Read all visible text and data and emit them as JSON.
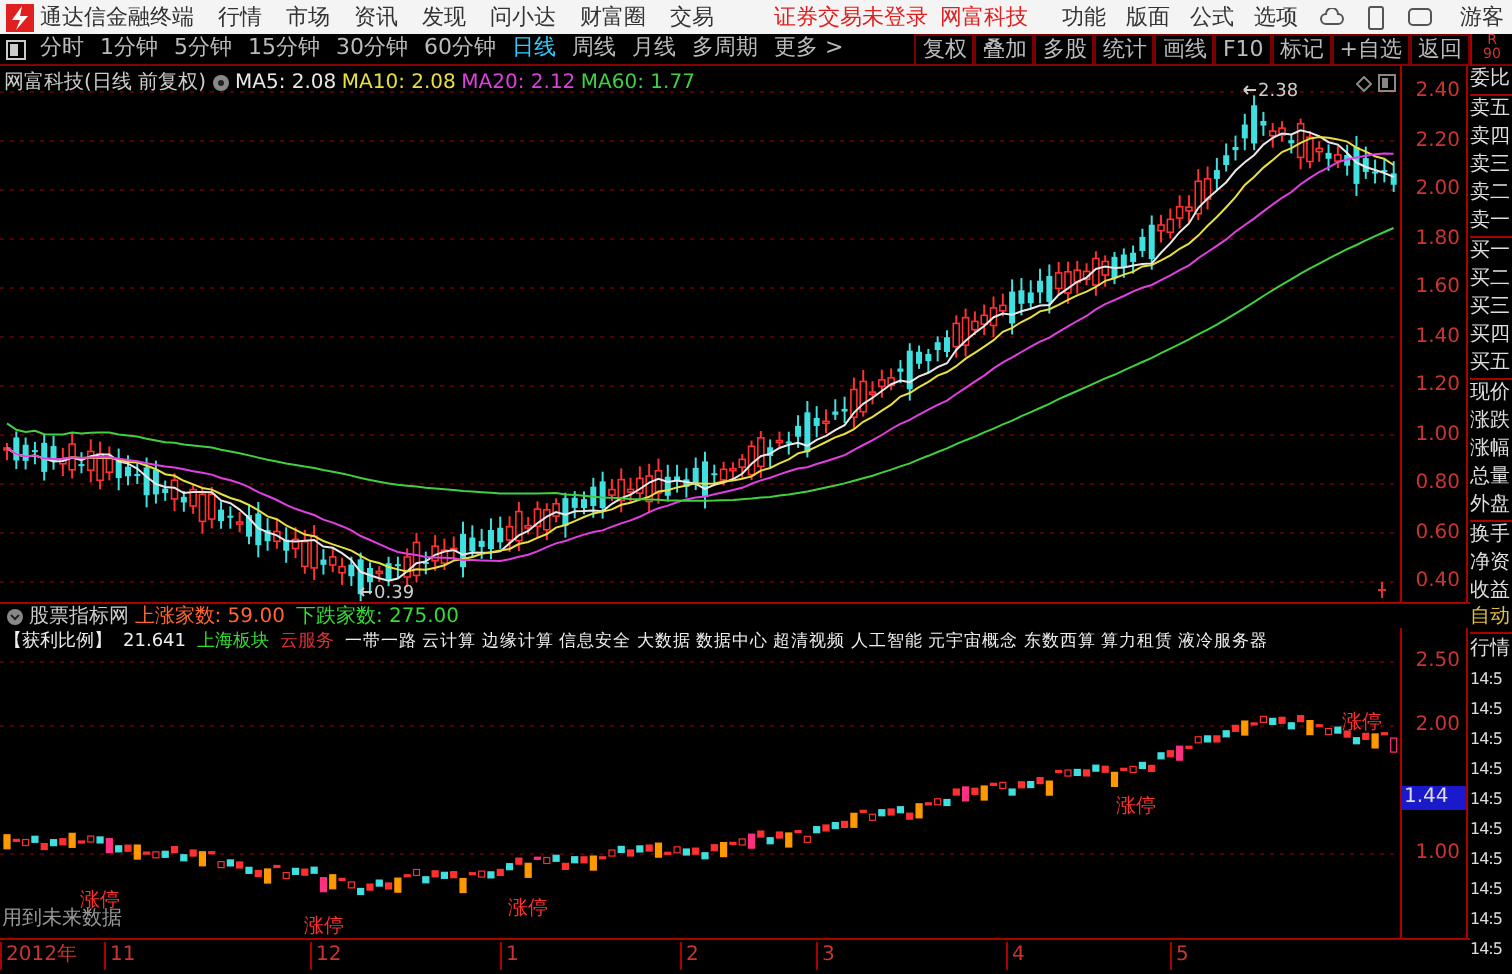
{
  "app_bar": {
    "title": "通达信金融终端",
    "menu": [
      "行情",
      "市场",
      "资讯",
      "发现",
      "问小达",
      "财富圈",
      "交易"
    ],
    "login_status": "证券交易未登录",
    "broker": "网富科技",
    "right_menu": [
      "功能",
      "版面",
      "公式",
      "选项"
    ],
    "user": "游客"
  },
  "period_tabs": [
    {
      "label": "分时",
      "selected": false
    },
    {
      "label": "1分钟",
      "selected": false
    },
    {
      "label": "5分钟",
      "selected": false
    },
    {
      "label": "15分钟",
      "selected": false
    },
    {
      "label": "30分钟",
      "selected": false
    },
    {
      "label": "60分钟",
      "selected": false
    },
    {
      "label": "日线",
      "selected": true
    },
    {
      "label": "周线",
      "selected": false
    },
    {
      "label": "月线",
      "selected": false
    },
    {
      "label": "多周期",
      "selected": false
    },
    {
      "label": "更多 >",
      "selected": false
    }
  ],
  "tool_buttons": [
    "复权",
    "叠加",
    "多股",
    "统计",
    "画线",
    "F10",
    "标记",
    "+自选",
    "返回"
  ],
  "corner_label": [
    "R",
    "90"
  ],
  "main_chart": {
    "title": "网富科技(日线 前复权)",
    "ma": [
      {
        "label": "MA5: 2.08",
        "color": "#e8e8e8"
      },
      {
        "label": "MA10: 2.08",
        "color": "#e8e040"
      },
      {
        "label": "MA20: 2.12",
        "color": "#e040e0"
      },
      {
        "label": "MA60: 1.77",
        "color": "#40d040"
      }
    ],
    "high_label": "2.38",
    "low_label": "0.39",
    "y_ticks": [
      "2.40",
      "2.20",
      "2.00",
      "1.80",
      "1.60",
      "1.40",
      "1.20",
      "1.00",
      "0.80",
      "0.60",
      "0.40"
    ]
  },
  "quote_groups": [
    [
      "委比"
    ],
    [
      "卖五",
      "卖四",
      "卖三",
      "卖二",
      "卖一"
    ],
    [
      "买一",
      "买二",
      "买三",
      "买四",
      "买五"
    ],
    [
      "现价",
      "涨跌",
      "涨幅",
      "总量",
      "外盘"
    ],
    [
      "换手",
      "净资",
      "收益"
    ]
  ],
  "indicator": {
    "name": "股票指标网",
    "stats": [
      {
        "label": "上涨家数: 59.00",
        "color": "#ff6633"
      },
      {
        "label": "下跌家数: 275.00",
        "color": "#33dd33"
      }
    ]
  },
  "info_row": {
    "label": "【获利比例】",
    "value": "21.641",
    "sector": "上海板块",
    "concept": "云服务",
    "concepts": "一带一路 云计算 边缘计算 信息安全 大数据 数据中心 超清视频 人工智能 元宇宙概念 东数西算 算力租赁 液冷服务器"
  },
  "lower_chart": {
    "y_ticks": [
      "2.50",
      "2.00",
      "1.00"
    ],
    "current": "1.44",
    "limit_up_labels": [
      "涨停",
      "涨停",
      "涨停",
      "涨停",
      "涨停"
    ],
    "note": "用到未来数据"
  },
  "side_panel": {
    "mode": "自动",
    "tab": "行情",
    "times": [
      "14:5",
      "14:5",
      "14:5",
      "14:5",
      "14:5",
      "14:5",
      "14:5",
      "14:5",
      "14:5",
      "14:5"
    ]
  },
  "x_axis": [
    "2012年",
    "11",
    "12",
    "1",
    "2",
    "3",
    "4",
    "5"
  ]
}
